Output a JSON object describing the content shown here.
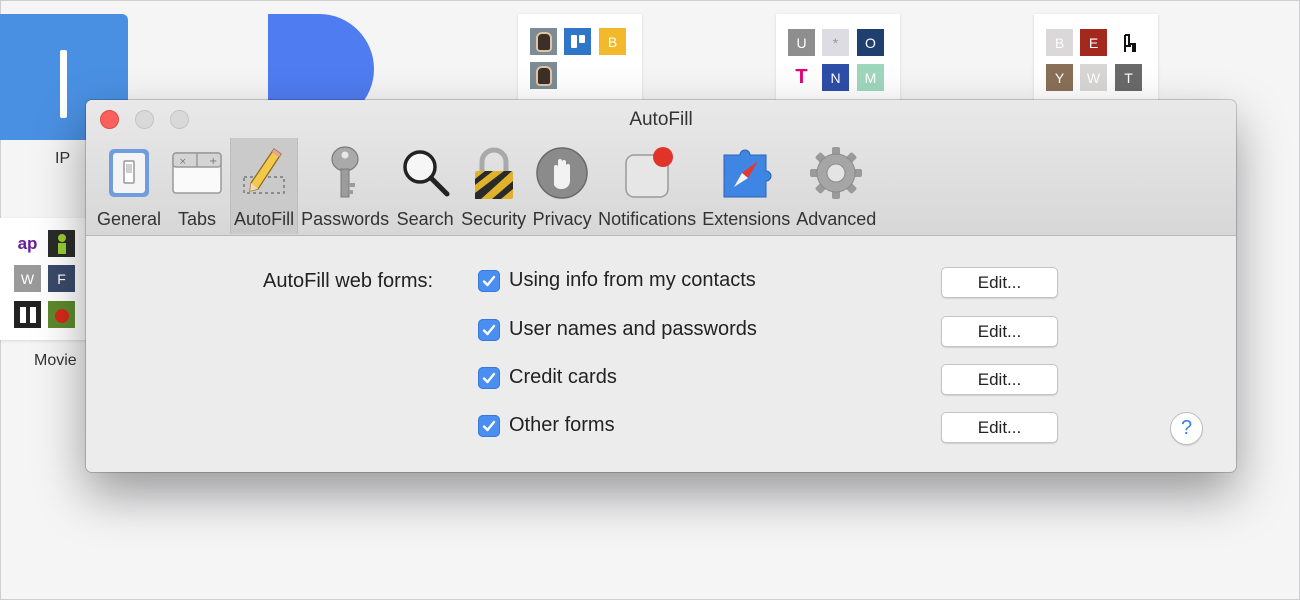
{
  "background": {
    "favorites": [
      {
        "caption": "IP"
      },
      {
        "caption": "Movie"
      }
    ],
    "tile_letters": {
      "tile3": [
        "B"
      ],
      "tile4": [
        "U",
        "O",
        "N",
        "M"
      ],
      "tile5": [
        "B",
        "E",
        "Y",
        "W",
        "T"
      ],
      "movie": [
        "ap",
        "W"
      ]
    },
    "colors": {
      "blue_tile": "#4a90e2",
      "d_logo": "#4f7cf0"
    }
  },
  "window": {
    "title": "AutoFill",
    "toolbar": [
      {
        "label": "General",
        "icon": "general-switch-icon"
      },
      {
        "label": "Tabs",
        "icon": "tabs-icon"
      },
      {
        "label": "AutoFill",
        "icon": "pencil-icon",
        "active": true
      },
      {
        "label": "Passwords",
        "icon": "key-icon"
      },
      {
        "label": "Search",
        "icon": "magnifier-icon"
      },
      {
        "label": "Security",
        "icon": "padlock-icon"
      },
      {
        "label": "Privacy",
        "icon": "hand-icon"
      },
      {
        "label": "Notifications",
        "icon": "notification-badge-icon"
      },
      {
        "label": "Extensions",
        "icon": "puzzle-compass-icon"
      },
      {
        "label": "Advanced",
        "icon": "gear-icon"
      }
    ]
  },
  "autofill": {
    "label": "AutoFill web forms:",
    "options": [
      {
        "text": "Using info from my contacts",
        "checked": true,
        "button": "Edit..."
      },
      {
        "text": "User names and passwords",
        "checked": true,
        "button": "Edit..."
      },
      {
        "text": "Credit cards",
        "checked": true,
        "button": "Edit..."
      },
      {
        "text": "Other forms",
        "checked": true,
        "button": "Edit..."
      }
    ],
    "help_label": "?"
  },
  "colors": {
    "accent": "#4b8ef1",
    "close": "#fc605c"
  }
}
